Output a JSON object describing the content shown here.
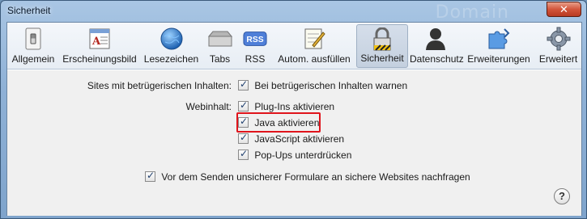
{
  "window": {
    "title": "Sicherheit",
    "close_label": "✕"
  },
  "toolbar": {
    "tabs": [
      {
        "label": "Allgemein",
        "icon": "switch-icon",
        "selected": false
      },
      {
        "label": "Erscheinungsbild",
        "icon": "appearance-icon",
        "selected": false
      },
      {
        "label": "Lesezeichen",
        "icon": "globe-icon",
        "selected": false
      },
      {
        "label": "Tabs",
        "icon": "tabs-icon",
        "selected": false
      },
      {
        "label": "RSS",
        "icon": "rss-icon",
        "selected": false
      },
      {
        "label": "Autom. ausfüllen",
        "icon": "autofill-icon",
        "selected": false
      },
      {
        "label": "Sicherheit",
        "icon": "lock-icon",
        "selected": true
      },
      {
        "label": "Datenschutz",
        "icon": "person-icon",
        "selected": false
      },
      {
        "label": "Erweiterungen",
        "icon": "puzzle-icon",
        "selected": false
      },
      {
        "label": "Erweitert",
        "icon": "gear-icon",
        "selected": false
      }
    ]
  },
  "security": {
    "fraud_label": "Sites mit betrügerischen Inhalten:",
    "fraud_option": {
      "label": "Bei betrügerischen Inhalten warnen",
      "checked": true
    },
    "webcontent_label": "Webinhalt:",
    "web_options": [
      {
        "label": "Plug-Ins aktivieren",
        "checked": true
      },
      {
        "label": "Java aktivieren",
        "checked": true
      },
      {
        "label": "JavaScript aktivieren",
        "checked": true
      },
      {
        "label": "Pop-Ups unterdrücken",
        "checked": true
      }
    ],
    "forms_option": {
      "label": "Vor dem Senden unsicherer Formulare an sichere Websites nachfragen",
      "checked": true
    }
  },
  "help_label": "?",
  "colors": {
    "highlight": "#e0141c",
    "selected_tab": "#c4d0df"
  }
}
